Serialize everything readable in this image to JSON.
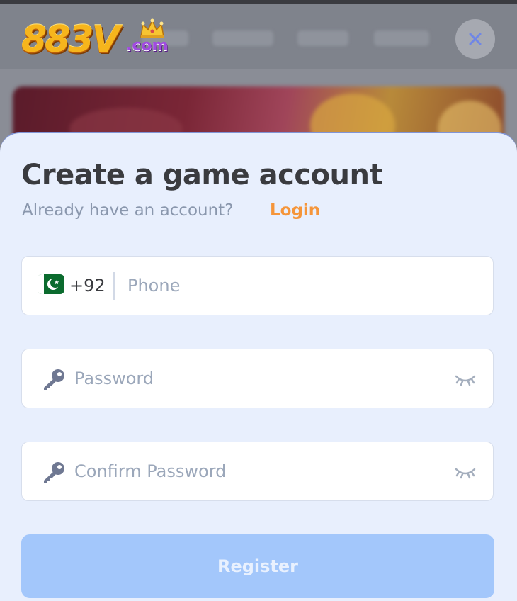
{
  "logo": {
    "main": "883V",
    "suffix": ".com"
  },
  "close_button": {
    "icon": "close-icon"
  },
  "modal": {
    "title": "Create a game account",
    "subtitle": "Already have an account?",
    "login_link": "Login"
  },
  "form": {
    "phone": {
      "country_flag": "pakistan-flag-icon",
      "country_code": "+92",
      "placeholder": "Phone",
      "value": ""
    },
    "password": {
      "icon": "key-icon",
      "placeholder": "Password",
      "value": "",
      "toggle_icon": "eye-closed-icon"
    },
    "confirm_password": {
      "icon": "key-icon",
      "placeholder": "Confirm Password",
      "value": "",
      "toggle_icon": "eye-closed-icon"
    },
    "register_label": "Register"
  },
  "colors": {
    "modal_background": "#e8effd",
    "accent_link": "#f5953a",
    "button_disabled": "#a3c7fb",
    "title_text": "#3a3b3f"
  }
}
